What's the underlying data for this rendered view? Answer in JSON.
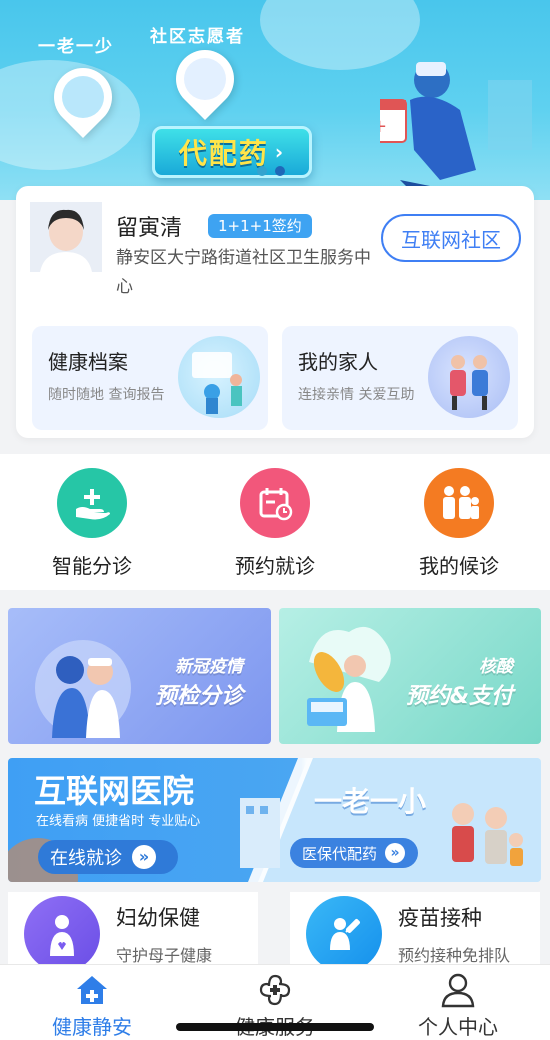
{
  "hero": {
    "tag_left": "一老一少",
    "tag_right": "社区志愿者",
    "cta_label": "代配药",
    "cta_arrow": "›"
  },
  "doctor": {
    "name": "留寅清",
    "badge": "1+1+1签约",
    "org": "静安区大宁路街道社区卫生服务中心",
    "community_button": "互联网社区"
  },
  "tiles": [
    {
      "title": "健康档案",
      "subtitle": "随时随地 查询报告"
    },
    {
      "title": "我的家人",
      "subtitle": "连接亲情 关爱互助"
    }
  ],
  "quick_actions": [
    {
      "label": "智能分诊",
      "color": "#26c6a6",
      "icon": "hand-plus-icon"
    },
    {
      "label": "预约就诊",
      "color": "#f2577b",
      "icon": "calendar-clock-icon"
    },
    {
      "label": "我的候诊",
      "color": "#f47b22",
      "icon": "family-icon"
    }
  ],
  "promos": [
    {
      "line1": "新冠疫情",
      "line2": "预检分诊",
      "color_from": "#9bb3f7",
      "color_to": "#7f98f0"
    },
    {
      "line1": "核酸",
      "line2": "预约&支付",
      "color_from": "#a6ece0",
      "color_to": "#74d6c6"
    }
  ],
  "internet_hospital": {
    "title": "互联网医院",
    "subtitle": "在线看病 便捷省时 专业贴心",
    "button": "在线就诊",
    "right_title": "一老一小",
    "right_button": "医保代配药",
    "chevrons": "»"
  },
  "services": [
    {
      "title": "妇幼保健",
      "subtitle": "守护母子健康",
      "color": "#7a5cf0",
      "icon": "mother-child-icon"
    },
    {
      "title": "疫苗接种",
      "subtitle": "预约接种免排队",
      "color": "#1ea8f4",
      "icon": "vaccine-icon"
    }
  ],
  "tabbar": [
    {
      "label": "健康静安",
      "active": true,
      "icon": "home-icon"
    },
    {
      "label": "健康服务",
      "active": false,
      "icon": "clover-cross-icon"
    },
    {
      "label": "个人中心",
      "active": false,
      "icon": "person-icon"
    }
  ],
  "colors": {
    "accent": "#2f7ee8",
    "hero_top": "#49c6ec"
  }
}
